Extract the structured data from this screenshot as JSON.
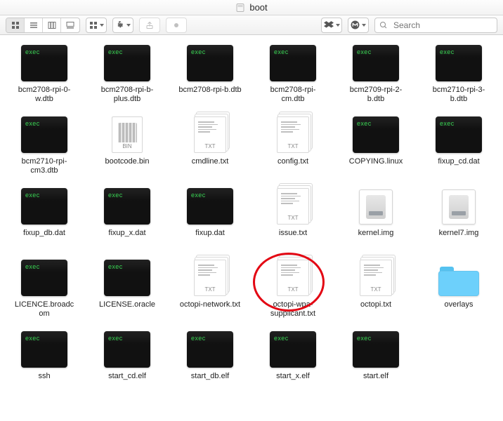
{
  "window": {
    "title": "boot"
  },
  "toolbar": {
    "search_placeholder": "Search",
    "exec_tag": "exec",
    "txt_badge": "TXT",
    "bin_badge": "BIN"
  },
  "files": [
    {
      "name": "bcm2708-rpi-0-w.dtb",
      "type": "exec"
    },
    {
      "name": "bcm2708-rpi-b-plus.dtb",
      "type": "exec"
    },
    {
      "name": "bcm2708-rpi-b.dtb",
      "type": "exec"
    },
    {
      "name": "bcm2708-rpi-cm.dtb",
      "type": "exec"
    },
    {
      "name": "bcm2709-rpi-2-b.dtb",
      "type": "exec"
    },
    {
      "name": "bcm2710-rpi-3-b.dtb",
      "type": "exec"
    },
    {
      "name": "bcm2710-rpi-cm3.dtb",
      "type": "exec"
    },
    {
      "name": "bootcode.bin",
      "type": "bin"
    },
    {
      "name": "cmdline.txt",
      "type": "txt"
    },
    {
      "name": "config.txt",
      "type": "txt"
    },
    {
      "name": "COPYING.linux",
      "type": "exec"
    },
    {
      "name": "fixup_cd.dat",
      "type": "exec"
    },
    {
      "name": "fixup_db.dat",
      "type": "exec"
    },
    {
      "name": "fixup_x.dat",
      "type": "exec"
    },
    {
      "name": "fixup.dat",
      "type": "exec"
    },
    {
      "name": "issue.txt",
      "type": "txt"
    },
    {
      "name": "kernel.img",
      "type": "img"
    },
    {
      "name": "kernel7.img",
      "type": "img"
    },
    {
      "name": "LICENCE.broadcom",
      "type": "exec"
    },
    {
      "name": "LICENSE.oracle",
      "type": "exec"
    },
    {
      "name": "octopi-network.txt",
      "type": "txt"
    },
    {
      "name": "octopi-wpa-supplicant.txt",
      "type": "txt",
      "highlighted": true
    },
    {
      "name": "octopi.txt",
      "type": "txt"
    },
    {
      "name": "overlays",
      "type": "folder"
    },
    {
      "name": "ssh",
      "type": "exec"
    },
    {
      "name": "start_cd.elf",
      "type": "exec"
    },
    {
      "name": "start_db.elf",
      "type": "exec"
    },
    {
      "name": "start_x.elf",
      "type": "exec"
    },
    {
      "name": "start.elf",
      "type": "exec"
    }
  ]
}
